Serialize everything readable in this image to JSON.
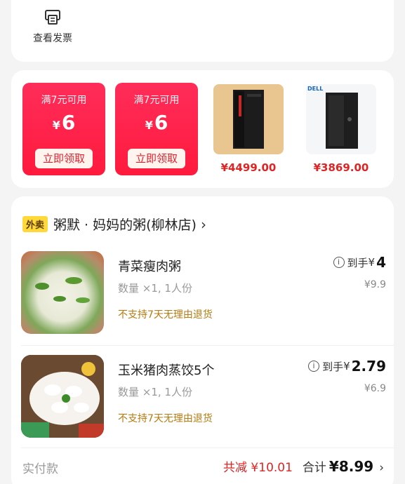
{
  "top": {
    "invoice_label": "查看发票",
    "invoice_icon": "receipt-icon"
  },
  "coupons": [
    {
      "condition": "满7元可用",
      "currency": "¥",
      "amount": "6",
      "button": "立即领取"
    },
    {
      "condition": "满7元可用",
      "currency": "¥",
      "amount": "6",
      "button": "立即领取"
    }
  ],
  "products": [
    {
      "price": "¥4499.00",
      "image": "lenovo-desktop-tower-image"
    },
    {
      "price": "¥3869.00",
      "image": "dell-desktop-tower-image",
      "brand": "DELL"
    }
  ],
  "order": {
    "tag": "外卖",
    "store": "粥默 · 妈妈的粥(柳林店)",
    "items": [
      {
        "name": "青菜瘦肉粥",
        "qty": "数量 ×1, 1人份",
        "policy": "不支持7天无理由退货",
        "deal_prefix": "到手",
        "deal_currency": "¥",
        "deal_price": "4",
        "orig_price": "¥9.9",
        "image": "porridge-image"
      },
      {
        "name": "玉米猪肉蒸饺5个",
        "qty": "数量 ×1, 1人份",
        "policy": "不支持7天无理由退货",
        "deal_prefix": "到手",
        "deal_currency": "¥",
        "deal_price": "2.79",
        "orig_price": "¥6.9",
        "image": "dumplings-image"
      }
    ],
    "footer": {
      "paid_label": "实付款",
      "saving": "共减 ¥10.01",
      "total_label": "合计",
      "total": "¥8.99",
      "arrow": "›"
    }
  },
  "colors": {
    "coupon_red": "#ff1a3d",
    "price_red": "#e02424",
    "tag_yellow": "#ffd93b",
    "policy_brown": "#b57a10"
  }
}
